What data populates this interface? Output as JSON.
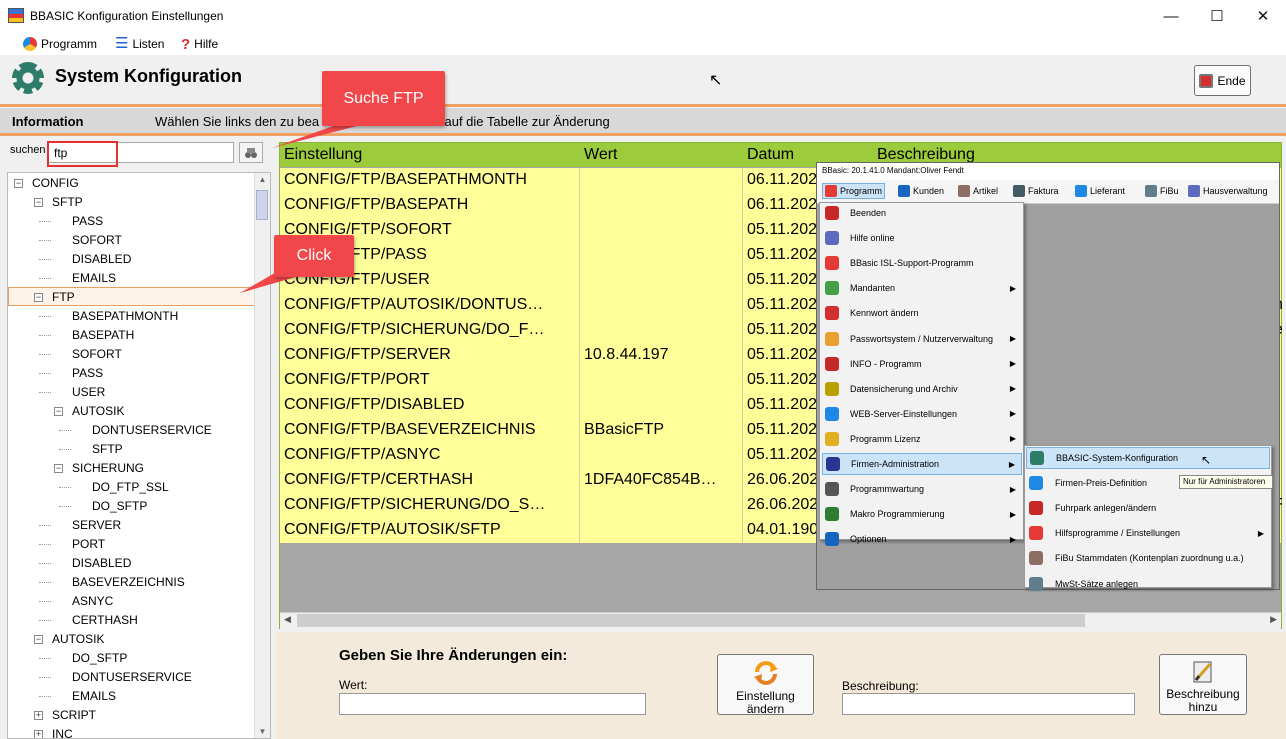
{
  "window": {
    "title": "BBASIC Konfiguration Einstellungen"
  },
  "menu": {
    "items": [
      {
        "label": "Programm"
      },
      {
        "label": "Listen"
      },
      {
        "label": "Hilfe"
      }
    ]
  },
  "header": {
    "title": "System Konfiguration",
    "ende_label": "Ende"
  },
  "info": {
    "label": "Information",
    "text": "Wählen Sie links den zu bea",
    "text_end": "ick auf die Tabelle zur Änderung"
  },
  "search": {
    "label": "suchen",
    "value": "ftp"
  },
  "callouts": {
    "search": "Suche FTP",
    "click": "Click"
  },
  "tree": [
    {
      "label": "CONFIG",
      "level": 0,
      "box": "-"
    },
    {
      "label": "SFTP",
      "level": 1,
      "box": "-"
    },
    {
      "label": "PASS",
      "level": 2
    },
    {
      "label": "SOFORT",
      "level": 2
    },
    {
      "label": "DISABLED",
      "level": 2
    },
    {
      "label": "EMAILS",
      "level": 2
    },
    {
      "label": "FTP",
      "level": 1,
      "box": "-",
      "selected": true
    },
    {
      "label": "BASEPATHMONTH",
      "level": 2
    },
    {
      "label": "BASEPATH",
      "level": 2
    },
    {
      "label": "SOFORT",
      "level": 2
    },
    {
      "label": "PASS",
      "level": 2
    },
    {
      "label": "USER",
      "level": 2
    },
    {
      "label": "AUTOSIK",
      "level": 2,
      "box": "-"
    },
    {
      "label": "DONTUSERSERVICE",
      "level": 3
    },
    {
      "label": "SFTP",
      "level": 3
    },
    {
      "label": "SICHERUNG",
      "level": 2,
      "box": "-"
    },
    {
      "label": "DO_FTP_SSL",
      "level": 3
    },
    {
      "label": "DO_SFTP",
      "level": 3
    },
    {
      "label": "SERVER",
      "level": 2
    },
    {
      "label": "PORT",
      "level": 2
    },
    {
      "label": "DISABLED",
      "level": 2
    },
    {
      "label": "BASEVERZEICHNIS",
      "level": 2
    },
    {
      "label": "ASNYC",
      "level": 2
    },
    {
      "label": "CERTHASH",
      "level": 2
    },
    {
      "label": "AUTOSIK",
      "level": 1,
      "box": "-"
    },
    {
      "label": "DO_SFTP",
      "level": 2
    },
    {
      "label": "DONTUSERSERVICE",
      "level": 2
    },
    {
      "label": "EMAILS",
      "level": 2
    },
    {
      "label": "SCRIPT",
      "level": 1,
      "box": "+"
    },
    {
      "label": "INC",
      "level": 1,
      "box": "+"
    }
  ],
  "grid": {
    "columns": [
      "Einstellung",
      "Wert",
      "Datum",
      "Beschreibung"
    ],
    "rows": [
      [
        "CONFIG/FTP/BASEPATHMONTH",
        "",
        "06.11.202",
        ""
      ],
      [
        "CONFIG/FTP/BASEPATH",
        "",
        "06.11.202",
        ""
      ],
      [
        "CONFIG/FTP/SOFORT",
        "",
        "05.11.202",
        ""
      ],
      [
        "CONFIG/FTP/PASS",
        "",
        "05.11.202",
        ""
      ],
      [
        "CONFIG/FTP/USER",
        "",
        "05.11.202",
        ""
      ],
      [
        "CONFIG/FTP/AUTOSIK/DONTUS…",
        "",
        "05.11.202",
        ""
      ],
      [
        "CONFIG/FTP/SICHERUNG/DO_F…",
        "",
        "05.11.202",
        ""
      ],
      [
        "CONFIG/FTP/SERVER",
        "10.8.44.197",
        "05.11.202",
        ""
      ],
      [
        "CONFIG/FTP/PORT",
        "",
        "05.11.202",
        ""
      ],
      [
        "CONFIG/FTP/DISABLED",
        "",
        "05.11.202",
        ""
      ],
      [
        "CONFIG/FTP/BASEVERZEICHNIS",
        "BBasicFTP",
        "05.11.202",
        ""
      ],
      [
        "CONFIG/FTP/ASNYC",
        "",
        "05.11.202",
        ""
      ],
      [
        "CONFIG/FTP/CERTHASH",
        "1DFA40FC854B…",
        "26.06.202",
        ""
      ],
      [
        "CONFIG/FTP/SICHERUNG/DO_S…",
        "",
        "26.06.202",
        ""
      ],
      [
        "CONFIG/FTP/AUTOSIK/SFTP",
        "",
        "04.01.190",
        ""
      ]
    ],
    "right_clip": [
      "",
      "",
      "",
      "",
      "",
      "he",
      "e",
      "",
      "",
      "",
      "",
      "",
      "",
      "F",
      ""
    ]
  },
  "edit": {
    "title": "Geben Sie Ihre Änderungen ein:",
    "wert_label": "Wert:",
    "besch_label": "Beschreibung:",
    "change_btn": "Einstellung ändern",
    "besch_btn": "Beschreibung hinzu"
  },
  "overlay": {
    "title": "BBasic: 20.1.41.0 Mandant:Oliver Fendt",
    "menubar": [
      "Programm",
      "Kunden",
      "Artikel",
      "Faktura",
      "Lieferant",
      "FiBu",
      "Hausverwaltung"
    ],
    "menu1": [
      {
        "label": "Beenden",
        "arrow": false,
        "color": "#c62828"
      },
      {
        "label": "Hilfe online",
        "arrow": false,
        "color": "#5c6bc0"
      },
      {
        "label": "BBasic ISL-Support-Programm",
        "arrow": false,
        "color": "#e53935"
      },
      {
        "label": "Mandanten",
        "arrow": true,
        "color": "#43a047"
      },
      {
        "label": "Kennwort ändern",
        "arrow": false,
        "color": "#d32f2f"
      },
      {
        "label": "Passwortsystem / Nutzerverwaltung",
        "arrow": true,
        "color": "#e8a030"
      },
      {
        "label": "INFO - Programm",
        "arrow": true,
        "color": "#c62828"
      },
      {
        "label": "Datensicherung und Archiv",
        "arrow": true,
        "color": "#b8a000"
      },
      {
        "label": "WEB-Server-Einstellungen",
        "arrow": true,
        "color": "#1e88e5"
      },
      {
        "label": "Programm Lizenz",
        "arrow": true,
        "color": "#e0b020"
      },
      {
        "label": "Firmen-Administration",
        "arrow": true,
        "color": "#283593",
        "active": true
      },
      {
        "label": "Programmwartung",
        "arrow": true,
        "color": "#555555"
      },
      {
        "label": "Makro Programmierung",
        "arrow": true,
        "color": "#2e7d32"
      },
      {
        "label": "Optionen",
        "arrow": true,
        "color": "#1565c0"
      }
    ],
    "menu2": [
      {
        "label": "BBASIC-System-Konfiguration",
        "arrow": false,
        "color": "#2e7c6a",
        "active": true
      },
      {
        "label": "Firmen-Preis-Definition",
        "arrow": false,
        "color": "#1e88e5"
      },
      {
        "label": "Fuhrpark anlegen/ändern",
        "arrow": false,
        "color": "#c62828"
      },
      {
        "label": "Hilfsprogramme / Einstellungen",
        "arrow": true,
        "color": "#e53935"
      },
      {
        "label": "FiBu Stammdaten (Kontenplan zuordnung u.a.)",
        "arrow": false,
        "color": "#8d6e63"
      },
      {
        "label": "MwSt-Sätze anlegen",
        "arrow": false,
        "color": "#607d8b"
      }
    ],
    "tooltip": "Nur für Administratoren"
  },
  "colors": {
    "grid_header": "#9ccc3c",
    "grid_row": "#ffff99",
    "accent": "#f0a060",
    "callout": "#f2474a"
  }
}
